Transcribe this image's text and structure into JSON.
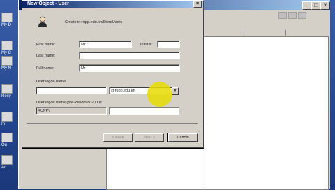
{
  "desktop": {
    "icons": [
      {
        "label": "My D",
        "icon": "documents-icon"
      },
      {
        "label": "My C",
        "icon": "computer-icon"
      },
      {
        "label": "My N",
        "icon": "network-icon"
      },
      {
        "label": "Recy",
        "icon": "recycle-bin-icon"
      },
      {
        "label": "In",
        "icon": "internet-icon"
      },
      {
        "label": "Ou",
        "icon": "outlook-icon"
      },
      {
        "label": "Ac",
        "icon": "shortcut-icon"
      }
    ]
  },
  "background_window": {
    "controls": {
      "minimize": "_",
      "maximize": "□",
      "close": "×"
    }
  },
  "dialog": {
    "title": "New Object - User",
    "close": "×",
    "create_in_label": "Create in:",
    "create_in_value": "rupp.edu.kh/StoreUsers",
    "first_name_label": "First name:",
    "first_name_value": "Mr",
    "initials_label": "Initials:",
    "initials_value": "",
    "last_name_label": "Last name:",
    "last_name_value": "",
    "full_name_label": "Full name:",
    "full_name_value": "Mr",
    "logon_name_label": "User logon name:",
    "logon_name_value": "",
    "domain_value": "@rupp.edu.kh",
    "pre2000_label": "User logon name (pre-Windows 2000):",
    "pre2000_domain": "RUPP\\",
    "pre2000_value": "",
    "buttons": {
      "back": "< Back",
      "next": "Next >",
      "cancel": "Cancel"
    }
  },
  "colors": {
    "title_bar": "#0a246a",
    "dialog_face": "#d4d0c8",
    "highlight": "#e6dc00",
    "desktop": "#24468f"
  }
}
